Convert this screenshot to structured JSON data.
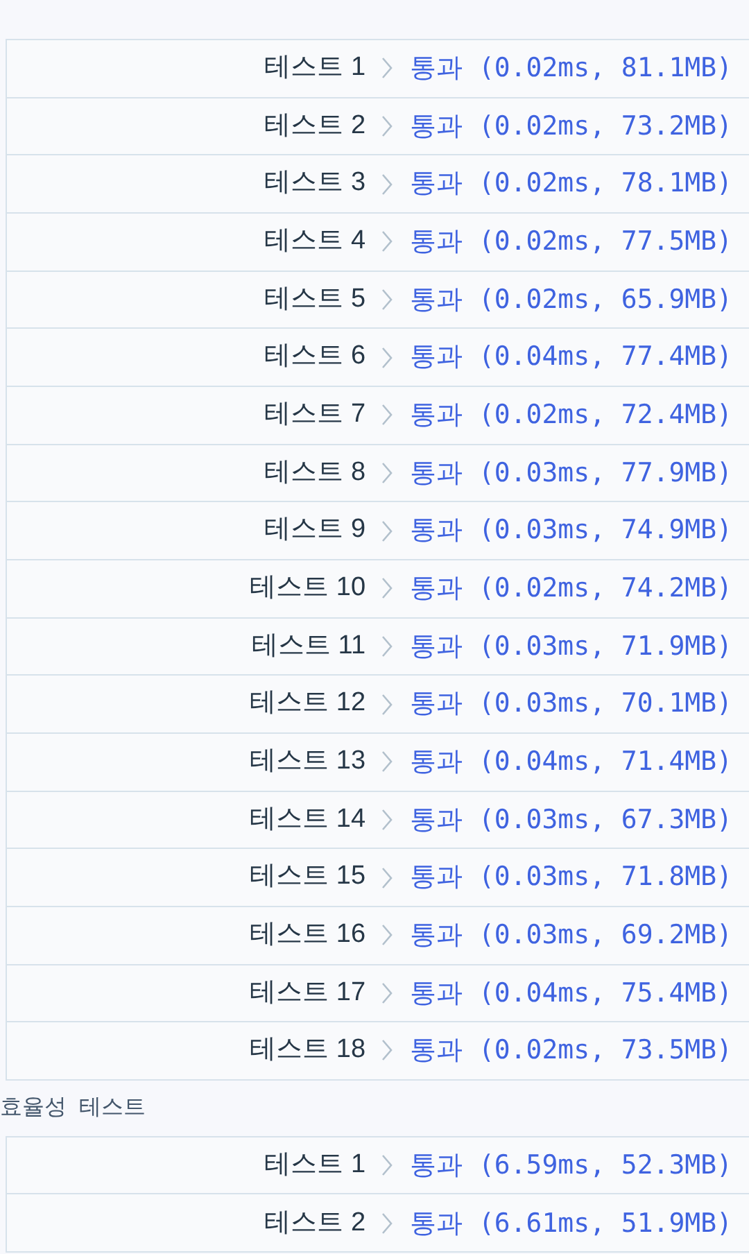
{
  "accuracy_tests": [
    {
      "label": "테스트 1",
      "result": "통과 (0.02ms, 81.1MB)"
    },
    {
      "label": "테스트 2",
      "result": "통과 (0.02ms, 73.2MB)"
    },
    {
      "label": "테스트 3",
      "result": "통과 (0.02ms, 78.1MB)"
    },
    {
      "label": "테스트 4",
      "result": "통과 (0.02ms, 77.5MB)"
    },
    {
      "label": "테스트 5",
      "result": "통과 (0.02ms, 65.9MB)"
    },
    {
      "label": "테스트 6",
      "result": "통과 (0.04ms, 77.4MB)"
    },
    {
      "label": "테스트 7",
      "result": "통과 (0.02ms, 72.4MB)"
    },
    {
      "label": "테스트 8",
      "result": "통과 (0.03ms, 77.9MB)"
    },
    {
      "label": "테스트 9",
      "result": "통과 (0.03ms, 74.9MB)"
    },
    {
      "label": "테스트 10",
      "result": "통과 (0.02ms, 74.2MB)"
    },
    {
      "label": "테스트 11",
      "result": "통과 (0.03ms, 71.9MB)"
    },
    {
      "label": "테스트 12",
      "result": "통과 (0.03ms, 70.1MB)"
    },
    {
      "label": "테스트 13",
      "result": "통과 (0.04ms, 71.4MB)"
    },
    {
      "label": "테스트 14",
      "result": "통과 (0.03ms, 67.3MB)"
    },
    {
      "label": "테스트 15",
      "result": "통과 (0.03ms, 71.8MB)"
    },
    {
      "label": "테스트 16",
      "result": "통과 (0.03ms, 69.2MB)"
    },
    {
      "label": "테스트 17",
      "result": "통과 (0.04ms, 75.4MB)"
    },
    {
      "label": "테스트 18",
      "result": "통과 (0.02ms, 73.5MB)"
    }
  ],
  "efficiency_section": {
    "title": "효율성  테스트",
    "tests": [
      {
        "label": "테스트 1",
        "result": "통과 (6.59ms, 52.3MB)"
      },
      {
        "label": "테스트 2",
        "result": "통과 (6.61ms, 51.9MB)"
      }
    ]
  }
}
